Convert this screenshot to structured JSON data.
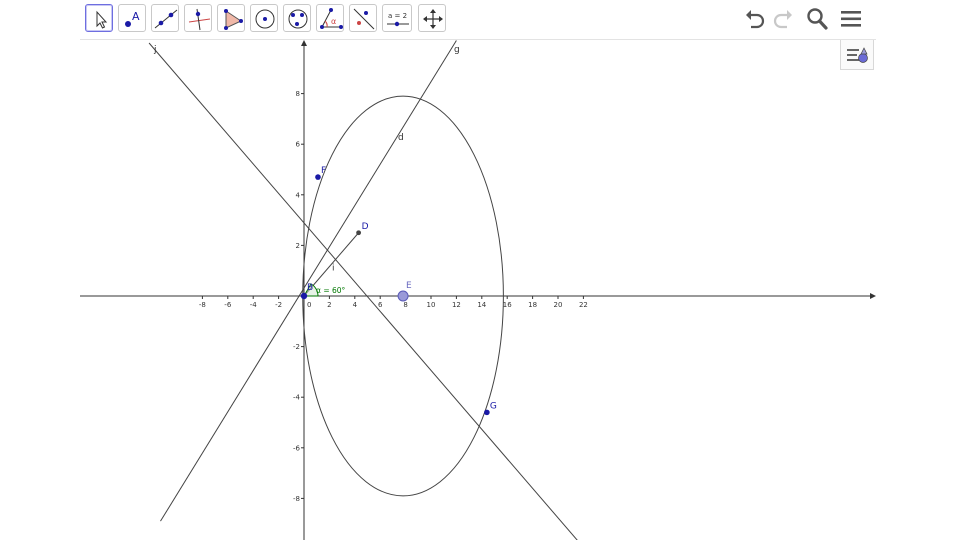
{
  "toolbar": {
    "tools": [
      {
        "name": "move-tool"
      },
      {
        "name": "point-tool",
        "label": "A"
      },
      {
        "name": "line-tool"
      },
      {
        "name": "perpendicular-line-tool"
      },
      {
        "name": "polygon-tool"
      },
      {
        "name": "circle-center-point-tool"
      },
      {
        "name": "circle-three-points-tool"
      },
      {
        "name": "angle-tool",
        "label": "α"
      },
      {
        "name": "reflect-tool"
      },
      {
        "name": "slider-tool",
        "label": "a = 2"
      },
      {
        "name": "move-graphics-view-tool"
      }
    ],
    "right": [
      "undo-icon",
      "redo-icon",
      "search-icon",
      "menu-icon"
    ]
  },
  "colors": {
    "axis": "#333333",
    "line": "#444444",
    "point_free": "#1a1aa6",
    "point_dependent": "#444444",
    "point_E_fill": "#9a9ad8",
    "angle": "#007700",
    "label_point": "#1a1aa6"
  },
  "graphics": {
    "x_ticks": [
      "-8",
      "-6",
      "-4",
      "-2",
      "0",
      "2",
      "4",
      "6",
      "8",
      "10",
      "12",
      "14",
      "16",
      "18",
      "20",
      "22"
    ],
    "y_ticks": [
      "8",
      "6",
      "4",
      "2",
      "0",
      "-2",
      "-4",
      "-6",
      "-8"
    ],
    "labels": {
      "line_j": "j",
      "line_g": "g",
      "line_d": "d",
      "segment_i": "i",
      "point_F": "F",
      "point_D": "D",
      "point_E": "E",
      "point_G": "G",
      "point_B": "B",
      "angle": "α = 60°"
    }
  }
}
